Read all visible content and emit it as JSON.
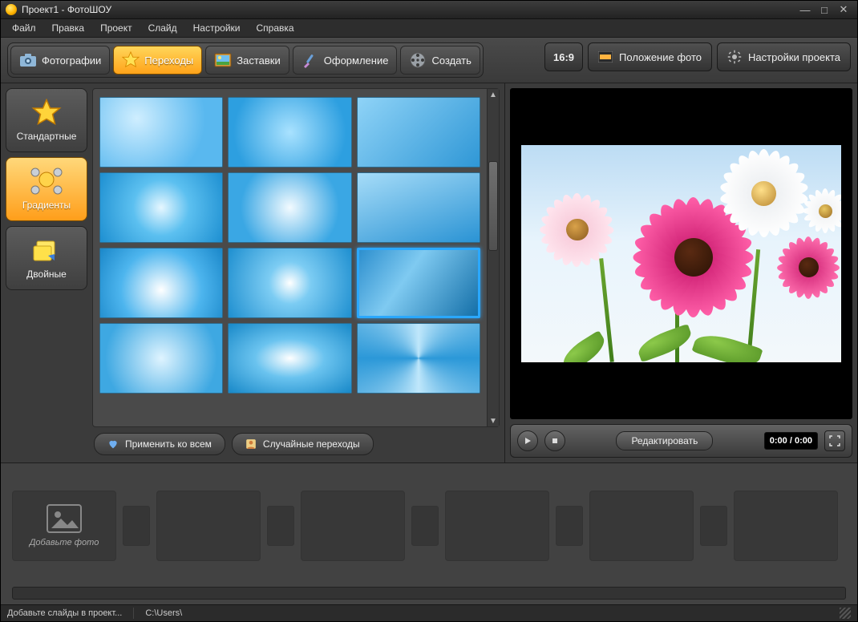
{
  "window": {
    "title": "Проект1 - ФотоШОУ"
  },
  "menu": [
    "Файл",
    "Правка",
    "Проект",
    "Слайд",
    "Настройки",
    "Справка"
  ],
  "tabs": {
    "photos": {
      "label": "Фотографии"
    },
    "transit": {
      "label": "Переходы"
    },
    "splash": {
      "label": "Заставки"
    },
    "design": {
      "label": "Оформление"
    },
    "create": {
      "label": "Создать"
    }
  },
  "active_tab": "transit",
  "top_right": {
    "ratio": "16:9",
    "position": "Положение фото",
    "settings": "Настройки проекта"
  },
  "categories": [
    {
      "key": "std",
      "label": "Стандартные"
    },
    {
      "key": "grad",
      "label": "Градиенты"
    },
    {
      "key": "dbl",
      "label": "Двойные"
    }
  ],
  "active_category": "grad",
  "thumb_count": 12,
  "selected_thumb": 8,
  "left_buttons": {
    "apply_all": "Применить ко всем",
    "random": "Случайные переходы"
  },
  "preview": {
    "edit": "Редактировать",
    "time": "0:00 / 0:00"
  },
  "timeline": {
    "hint": "Добавьте фото"
  },
  "status": {
    "hint": "Добавьте слайды в проект...",
    "path": "C:\\Users\\"
  }
}
